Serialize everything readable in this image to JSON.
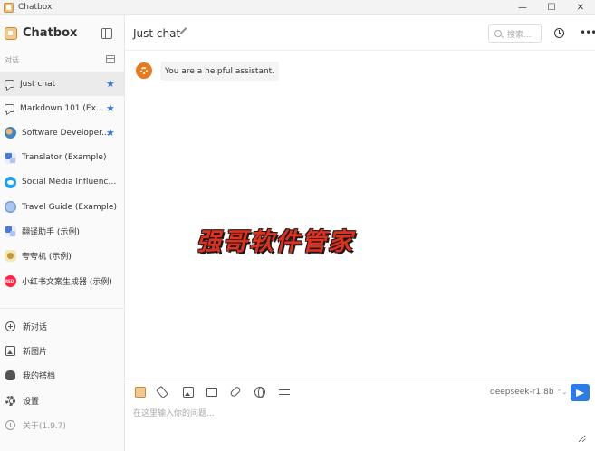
{
  "window": {
    "title": "Chatbox"
  },
  "sidebar": {
    "brand": "Chatbox",
    "section_label": "对话",
    "conversations": [
      {
        "label": "Just chat",
        "starred": true,
        "icon": "chat-icon"
      },
      {
        "label": "Markdown 101 (Ex...",
        "starred": true,
        "icon": "chat-icon"
      },
      {
        "label": "Software Developer...",
        "starred": true,
        "icon": "developer-avatar-icon"
      },
      {
        "label": "Translator (Example)",
        "starred": false,
        "icon": "translator-avatar-icon"
      },
      {
        "label": "Social Media Influencer (...",
        "starred": false,
        "icon": "twitter-avatar-icon"
      },
      {
        "label": "Travel Guide (Example)",
        "starred": false,
        "icon": "travel-avatar-icon"
      },
      {
        "label": "翻译助手 (示例)",
        "starred": false,
        "icon": "translator-avatar-icon"
      },
      {
        "label": "夸夸机 (示例)",
        "starred": false,
        "icon": "bot-avatar-icon"
      },
      {
        "label": "小红书文案生成器 (示例)",
        "starred": false,
        "icon": "redbook-avatar-icon"
      }
    ],
    "menu": [
      {
        "label": "新对话",
        "icon": "plus-circle-icon"
      },
      {
        "label": "新图片",
        "icon": "image-icon"
      },
      {
        "label": "我的搭档",
        "icon": "partner-icon"
      },
      {
        "label": "设置",
        "icon": "gear-icon"
      },
      {
        "label": "关于(1.9.7)",
        "icon": "info-icon"
      }
    ]
  },
  "header": {
    "title": "Just chat",
    "search_placeholder": "搜索..."
  },
  "messages": [
    {
      "role": "system",
      "text": "You are a helpful assistant."
    }
  ],
  "watermark": "强哥软件管家",
  "composer": {
    "model": "deepseek-r1:8b",
    "placeholder": "在这里输入你的问题..."
  },
  "colors": {
    "accent": "#2b7ce9",
    "star": "#3478d4",
    "system_avatar": "#e6791c",
    "watermark": "#e0301e"
  }
}
